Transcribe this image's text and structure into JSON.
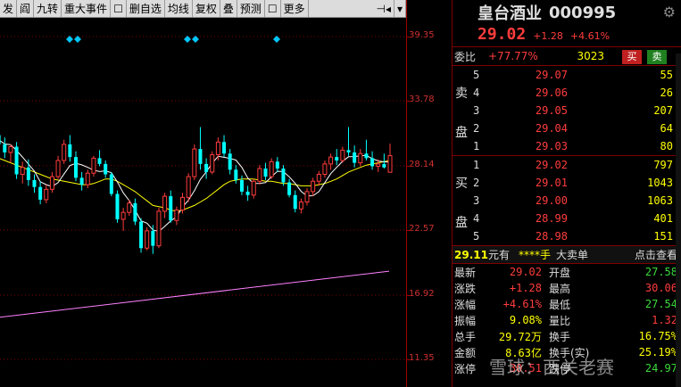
{
  "toolbar": {
    "items": [
      "发",
      "阎",
      "九转",
      "重大事件",
      "",
      "删自选",
      "均线",
      "复权",
      "叠",
      "预测",
      "",
      "更多"
    ],
    "icons": [
      "check-icon",
      "chevron-down-icon",
      "cursor-icon",
      "chevron-down-icon"
    ]
  },
  "axis": {
    "labels": [
      "39.35",
      "33.78",
      "28.14",
      "22.57",
      "16.92",
      "11.35"
    ]
  },
  "stock": {
    "name": "皇台酒业",
    "code": "000995",
    "price": "29.02",
    "change": "+1.28",
    "pct": "+4.61%"
  },
  "webi": {
    "label": "委比",
    "pct": "+77.77%",
    "vol": "3023",
    "buy": "买",
    "sell": "卖"
  },
  "ask": {
    "side": "卖盘",
    "rows": [
      {
        "level": "5",
        "price": "29.07",
        "qty": "55"
      },
      {
        "level": "4",
        "price": "29.06",
        "qty": "26"
      },
      {
        "level": "3",
        "price": "29.05",
        "qty": "207"
      },
      {
        "level": "2",
        "price": "29.04",
        "qty": "64"
      },
      {
        "level": "1",
        "price": "29.03",
        "qty": "80"
      }
    ]
  },
  "bid": {
    "side": "买盘",
    "rows": [
      {
        "level": "1",
        "price": "29.02",
        "qty": "797"
      },
      {
        "level": "2",
        "price": "29.01",
        "qty": "1043"
      },
      {
        "level": "3",
        "price": "29.00",
        "qty": "1063"
      },
      {
        "level": "4",
        "price": "28.99",
        "qty": "401"
      },
      {
        "level": "5",
        "price": "28.98",
        "qty": "151"
      }
    ]
  },
  "midline": {
    "price": "29.11",
    "unit": "元有",
    "hand": "****手",
    "tab1": "大卖单",
    "tab2": "点击查看"
  },
  "stats": [
    {
      "k": "最新",
      "v": "29.02",
      "vc": "red",
      "k2": "开盘",
      "v2": "27.58",
      "v2c": "green"
    },
    {
      "k": "涨跌",
      "v": "+1.28",
      "vc": "red",
      "k2": "最高",
      "v2": "30.06",
      "v2c": "red"
    },
    {
      "k": "涨幅",
      "v": "+4.61%",
      "vc": "red",
      "k2": "最低",
      "v2": "27.54",
      "v2c": "green"
    },
    {
      "k": "振幅",
      "v": "9.08%",
      "vc": "yellow",
      "k2": "量比",
      "v2": "1.32",
      "v2c": "red"
    },
    {
      "k": "总手",
      "v": "29.72万",
      "vc": "yellow",
      "k2": "换手",
      "v2": "16.75%",
      "v2c": "yellow"
    },
    {
      "k": "金额",
      "v": "8.63亿",
      "vc": "yellow",
      "k2": "换手(实)",
      "v2": "25.19%",
      "v2c": "yellow"
    },
    {
      "k": "涨停",
      "v": "30.51",
      "vc": "red",
      "k2": "跌停",
      "v2": "24.97",
      "v2c": "green"
    }
  ],
  "watermark": "雪球：西关老赛",
  "colors": {
    "up": "#ff3c3c",
    "down": "#00ffff",
    "ma5": "#ffffff",
    "ma10": "#ffff00",
    "ma250": "#ff80ff"
  },
  "chart_data": {
    "type": "candlestick",
    "y_range": [
      11.35,
      39.35
    ],
    "candles": [
      [
        31.0,
        31.5,
        30.2,
        30.8
      ],
      [
        30.8,
        31.2,
        29.5,
        30.0
      ],
      [
        30.0,
        30.6,
        28.8,
        29.3
      ],
      [
        29.3,
        30.0,
        28.4,
        29.8
      ],
      [
        29.8,
        30.2,
        27.0,
        27.4
      ],
      [
        27.4,
        28.5,
        26.6,
        28.0
      ],
      [
        28.0,
        28.7,
        26.4,
        26.9
      ],
      [
        26.9,
        27.4,
        25.8,
        26.3
      ],
      [
        26.3,
        26.8,
        24.8,
        25.2
      ],
      [
        25.2,
        26.5,
        24.9,
        26.1
      ],
      [
        26.1,
        27.6,
        25.8,
        27.2
      ],
      [
        27.2,
        29.0,
        27.0,
        28.6
      ],
      [
        28.6,
        30.4,
        28.3,
        30.0
      ],
      [
        30.0,
        30.8,
        28.5,
        28.9
      ],
      [
        28.9,
        29.4,
        26.8,
        27.1
      ],
      [
        27.1,
        27.6,
        26.0,
        26.5
      ],
      [
        26.5,
        27.8,
        26.2,
        27.5
      ],
      [
        27.5,
        29.0,
        27.2,
        28.8
      ],
      [
        28.8,
        29.5,
        28.1,
        28.3
      ],
      [
        28.3,
        28.6,
        27.1,
        27.4
      ],
      [
        27.4,
        27.6,
        25.5,
        25.7
      ],
      [
        25.7,
        26.0,
        23.2,
        23.5
      ],
      [
        23.5,
        24.5,
        22.5,
        24.1
      ],
      [
        24.1,
        25.2,
        23.8,
        24.9
      ],
      [
        24.9,
        25.3,
        23.0,
        23.3
      ],
      [
        23.3,
        23.6,
        20.6,
        21.0
      ],
      [
        21.0,
        22.8,
        20.8,
        22.5
      ],
      [
        22.5,
        23.0,
        20.5,
        21.2
      ],
      [
        21.2,
        24.5,
        21.0,
        24.2
      ],
      [
        24.2,
        25.8,
        23.6,
        25.5
      ],
      [
        25.5,
        26.0,
        23.2,
        23.4
      ],
      [
        23.4,
        24.6,
        23.0,
        24.3
      ],
      [
        24.3,
        25.8,
        24.0,
        25.4
      ],
      [
        25.4,
        27.5,
        25.0,
        27.2
      ],
      [
        27.2,
        30.0,
        26.9,
        29.6
      ],
      [
        29.6,
        31.5,
        27.8,
        28.3
      ],
      [
        28.3,
        28.8,
        27.0,
        27.6
      ],
      [
        27.6,
        29.4,
        27.4,
        29.1
      ],
      [
        29.1,
        30.6,
        28.6,
        30.2
      ],
      [
        30.2,
        30.8,
        28.9,
        29.2
      ],
      [
        29.2,
        29.6,
        27.4,
        27.8
      ],
      [
        27.8,
        28.2,
        26.6,
        26.9
      ],
      [
        26.9,
        27.3,
        25.6,
        25.9
      ],
      [
        25.9,
        26.4,
        25.1,
        25.6
      ],
      [
        25.6,
        27.0,
        25.3,
        26.8
      ],
      [
        26.8,
        28.2,
        26.5,
        27.9
      ],
      [
        27.9,
        28.4,
        26.9,
        27.2
      ],
      [
        27.2,
        28.8,
        27.0,
        28.5
      ],
      [
        28.5,
        28.9,
        27.6,
        27.9
      ],
      [
        27.9,
        28.2,
        26.4,
        26.7
      ],
      [
        26.7,
        27.0,
        25.4,
        25.6
      ],
      [
        25.6,
        26.0,
        24.1,
        24.4
      ],
      [
        24.4,
        25.3,
        24.0,
        25.0
      ],
      [
        25.0,
        26.2,
        24.7,
        25.9
      ],
      [
        25.9,
        27.1,
        25.5,
        26.8
      ],
      [
        26.8,
        27.7,
        26.4,
        27.4
      ],
      [
        27.4,
        28.6,
        27.1,
        28.3
      ],
      [
        28.3,
        29.2,
        27.8,
        28.9
      ],
      [
        28.9,
        29.6,
        28.2,
        28.6
      ],
      [
        28.6,
        29.8,
        28.4,
        29.5
      ],
      [
        29.5,
        31.5,
        29.0,
        29.3
      ],
      [
        29.3,
        29.9,
        28.0,
        28.4
      ],
      [
        28.4,
        29.6,
        28.1,
        29.2
      ],
      [
        29.2,
        30.4,
        28.6,
        28.8
      ],
      [
        28.8,
        29.4,
        27.8,
        28.1
      ],
      [
        28.1,
        28.7,
        27.6,
        28.3
      ],
      [
        28.3,
        29.2,
        27.9,
        28.0
      ],
      [
        27.58,
        30.06,
        27.54,
        29.02
      ]
    ],
    "ma10": [
      28.9,
      28.8,
      28.6,
      28.4,
      28.2,
      28.0,
      27.8,
      27.6,
      27.4,
      27.2,
      27.0,
      26.9,
      26.8,
      26.7,
      26.6,
      26.5,
      26.5,
      26.6,
      26.8,
      27.0,
      27.0,
      26.8,
      26.5,
      26.2,
      25.9,
      25.5,
      25.1,
      24.7,
      24.6,
      24.5,
      24.3,
      24.2,
      24.3,
      24.5,
      24.7,
      25.0,
      25.3,
      25.7,
      26.1,
      26.5,
      26.8,
      26.9,
      27.0,
      27.0,
      27.0,
      26.9,
      26.8,
      26.8,
      26.7,
      26.6,
      26.6,
      26.5,
      26.4,
      26.4,
      26.4,
      26.5,
      26.6,
      26.8,
      27.0,
      27.3,
      27.6,
      27.8,
      28.0,
      28.2,
      28.3,
      28.4,
      28.5,
      28.6
    ],
    "ma250": [
      15.0,
      19.0
    ]
  }
}
